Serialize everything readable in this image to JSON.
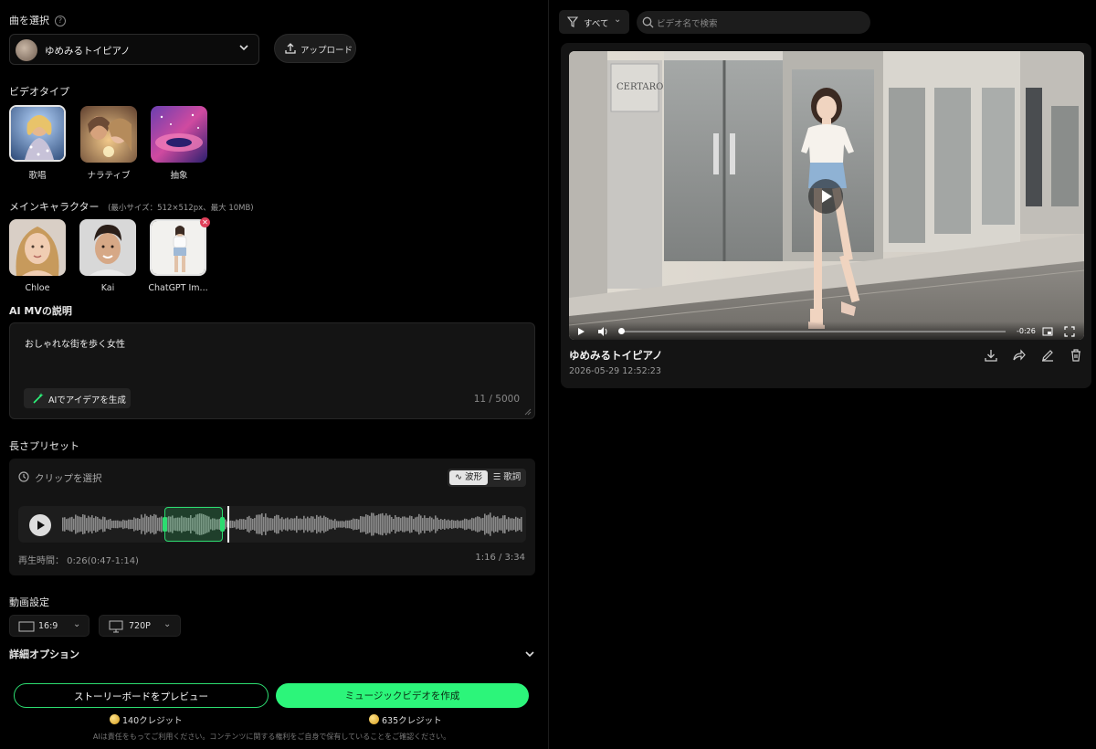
{
  "left": {
    "song_section_label": "曲を選択",
    "song_name": "ゆめみるトイピアノ",
    "upload_label": "アップロード",
    "video_type_label": "ビデオタイプ",
    "video_types": [
      {
        "label": "歌唱",
        "selected": true
      },
      {
        "label": "ナラティブ",
        "selected": false
      },
      {
        "label": "抽象",
        "selected": false
      }
    ],
    "main_character_label": "メインキャラクター",
    "main_character_hint": "(最小サイズ：512×512px、最大 10MB)",
    "characters": [
      {
        "label": "Chloe"
      },
      {
        "label": "Kai"
      },
      {
        "label": "ChatGPT Im..."
      }
    ],
    "description_label": "AI MVの説明",
    "description_text": "おしゃれな街を歩く女性",
    "ai_idea_label": "AIでアイデアを生成",
    "char_count": "11 / 5000",
    "length_preset_label": "長さプリセット",
    "clip_select_label": "クリップを選択",
    "toggle_wave": "波形",
    "toggle_lyrics": "歌詞",
    "playback_time": "再生時間： 0:26(0:47-1:14)",
    "position_time": "1:16 / 3:34",
    "clip_selection": {
      "start": "0:47",
      "end": "1:14",
      "total": "3:34",
      "playhead": "1:16"
    },
    "video_settings_label": "動画設定",
    "aspect_ratio": "16:9",
    "resolution": "720P",
    "advanced_options_label": "詳細オプション",
    "preview_button": "ストーリーボードをプレビュー",
    "create_button": "ミュージックビデオを作成",
    "preview_credits": "140クレジット",
    "create_credits": "635クレジット",
    "disclaimer": "AIは責任をもってご利用ください。コンテンツに関する権利をご自身で保有していることをご確認ください。"
  },
  "right": {
    "filter_label": "すべて",
    "search_placeholder": "ビデオ名で検索",
    "video": {
      "title": "ゆめみるトイピアノ",
      "date": "2026-05-29 12:52:23",
      "remaining_time": "-0:26",
      "storefront_sign": "CERTARON"
    }
  },
  "colors": {
    "accent_green": "#2cf57a",
    "panel_bg": "#141414",
    "background": "#000000"
  }
}
